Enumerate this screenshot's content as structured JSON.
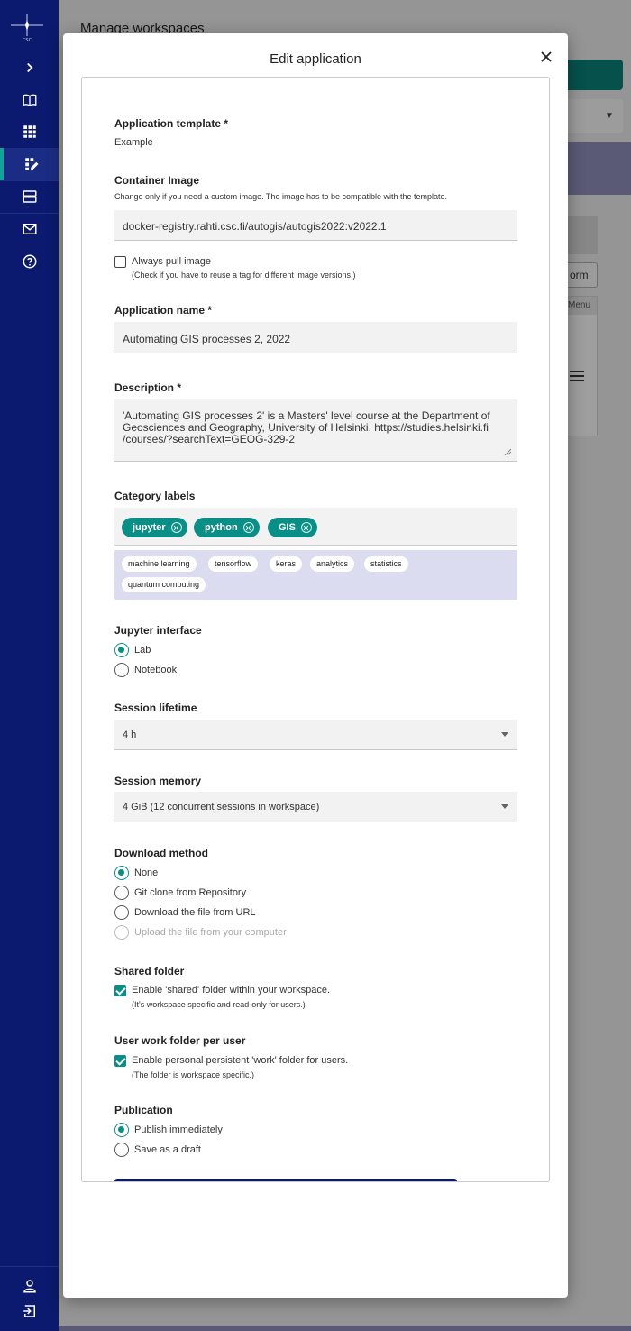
{
  "background_page": {
    "title": "Manage workspaces",
    "button_fragment": "orm",
    "table_header_fragment": "Menu"
  },
  "sidebar": {
    "logo_text": "CSC",
    "items": [
      {
        "name": "expand",
        "icon": "chevron-right-icon"
      },
      {
        "name": "catalog",
        "icon": "book-icon"
      },
      {
        "name": "my-workspaces",
        "icon": "grid-icon"
      },
      {
        "name": "manage-workspaces",
        "icon": "edit-grid-icon",
        "active": true
      },
      {
        "name": "sessions",
        "icon": "server-icon"
      },
      {
        "name": "messages",
        "icon": "mail-icon"
      },
      {
        "name": "help",
        "icon": "help-icon"
      },
      {
        "name": "account",
        "icon": "user-icon"
      },
      {
        "name": "logout",
        "icon": "logout-icon"
      }
    ]
  },
  "modal": {
    "title": "Edit application",
    "template": {
      "label": "Application template *",
      "value": "Example"
    },
    "container_image": {
      "label": "Container Image",
      "hint": "Change only if you need a custom image. The image has to be compatible with the template.",
      "value": "docker-registry.rahti.csc.fi/autogis/autogis2022:v2022.1"
    },
    "always_pull": {
      "label": "Always pull image",
      "hint": "(Check if you have to reuse a tag for different image versions.)",
      "checked": false
    },
    "app_name": {
      "label": "Application name *",
      "value": "Automating GIS processes 2, 2022"
    },
    "description": {
      "label": "Description *",
      "line1": "'Automating GIS processes 2' is a Masters' level course at the Department of",
      "line2": "Geosciences and Geography, University of Helsinki. https://studies.helsinki.fi",
      "line3": "/courses/?searchText=GEOG-329-2"
    },
    "category_labels": {
      "label": "Category labels",
      "selected": [
        "jupyter",
        "python",
        "GIS"
      ],
      "suggestions": [
        "machine learning",
        "tensorflow",
        "keras",
        "analytics",
        "statistics",
        "quantum computing"
      ]
    },
    "jupyter_interface": {
      "label": "Jupyter interface",
      "options": [
        "Lab",
        "Notebook"
      ],
      "selected": "Lab"
    },
    "session_lifetime": {
      "label": "Session lifetime",
      "value": "4 h"
    },
    "session_memory": {
      "label": "Session memory",
      "value": "4 GiB (12 concurrent sessions in workspace)"
    },
    "download_method": {
      "label": "Download method",
      "options": [
        "None",
        "Git clone from Repository",
        "Download the file from URL",
        "Upload the file from your computer"
      ],
      "selected": "None"
    },
    "shared_folder": {
      "label": "Shared folder",
      "checkbox_label": "Enable 'shared' folder within your workspace.",
      "hint": "(It's workspace specific and read-only for users.)",
      "checked": true
    },
    "work_folder": {
      "label": "User work folder per user",
      "checkbox_label": "Enable personal persistent 'work' folder for users.",
      "hint": "(The folder is workspace specific.)",
      "checked": true
    },
    "publication": {
      "label": "Publication",
      "options": [
        "Publish immediately",
        "Save as a draft"
      ],
      "selected": "Publish immediately"
    }
  },
  "colors": {
    "sidebar": "#0b1a6e",
    "accent": "#0a8f87",
    "suggestion_bg": "#dcdcf0"
  }
}
